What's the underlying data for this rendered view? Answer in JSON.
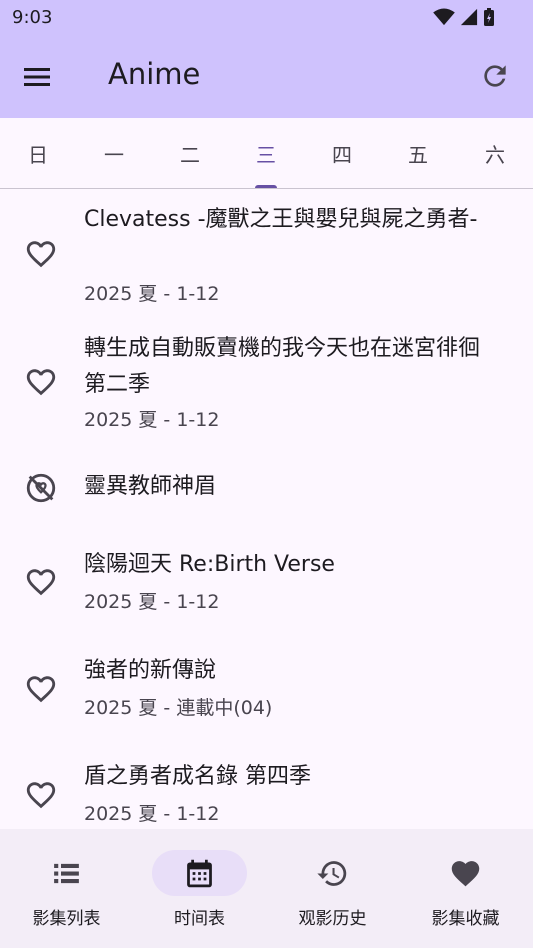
{
  "status": {
    "time": "9:03"
  },
  "app_bar": {
    "title": "Anime",
    "menu_icon": "menu-icon",
    "refresh_icon": "refresh-icon"
  },
  "tabs": [
    {
      "label": "日",
      "active": false
    },
    {
      "label": "一",
      "active": false
    },
    {
      "label": "二",
      "active": false
    },
    {
      "label": "三",
      "active": true
    },
    {
      "label": "四",
      "active": false
    },
    {
      "label": "五",
      "active": false
    },
    {
      "label": "六",
      "active": false
    }
  ],
  "items": [
    {
      "title": "Clevatess -魔獸之王與嬰兒與屍之勇者-",
      "subtitle": "2025 夏 - 1-12",
      "icon": "heart-outline-icon"
    },
    {
      "title": "轉生成自動販賣機的我今天也在迷宮徘徊 第二季",
      "subtitle": "2025 夏 - 1-12",
      "icon": "heart-outline-icon"
    },
    {
      "title": "靈異教師神眉",
      "subtitle": "",
      "icon": "heart-broken-icon"
    },
    {
      "title": "陰陽迴天 Re:Birth Verse",
      "subtitle": "2025 夏 - 1-12",
      "icon": "heart-outline-icon"
    },
    {
      "title": "強者的新傳說",
      "subtitle": "2025 夏 - 連載中(04)",
      "icon": "heart-outline-icon"
    },
    {
      "title": "盾之勇者成名錄 第四季",
      "subtitle": "2025 夏 - 1-12",
      "icon": "heart-outline-icon"
    }
  ],
  "nav": [
    {
      "label": "影集列表",
      "icon": "list-icon",
      "active": false
    },
    {
      "label": "时间表",
      "icon": "calendar-icon",
      "active": true
    },
    {
      "label": "观影历史",
      "icon": "history-icon",
      "active": false
    },
    {
      "label": "影集收藏",
      "icon": "heart-icon",
      "active": false
    }
  ],
  "colors": {
    "app_bar": "#cfc2fd",
    "accent": "#6750a4",
    "nav_bg": "#f3edf7",
    "pill": "#e8def8"
  }
}
